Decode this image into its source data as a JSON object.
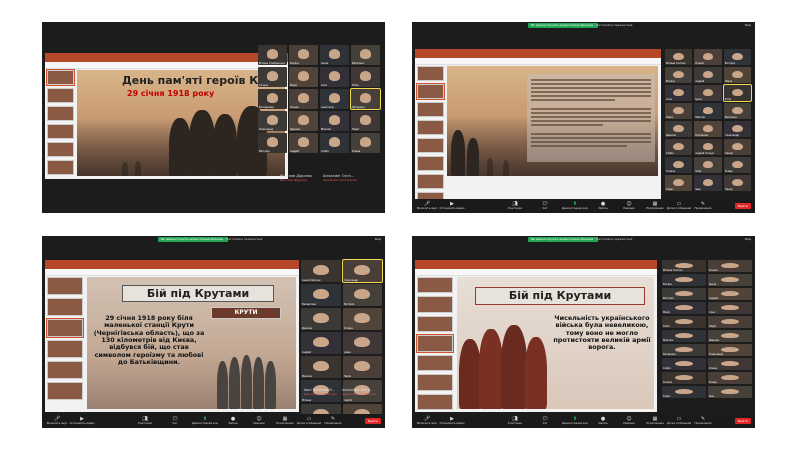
{
  "zoom": {
    "share_banner": "Ви демонструєте екран Олена Франків",
    "share_options": "Настройки презентації",
    "view_label": "Вид",
    "controls": [
      {
        "icon": "mic-icon",
        "label": "Включить звук"
      },
      {
        "icon": "video-icon",
        "label": "Остановить видео"
      },
      {
        "icon": "participants-icon",
        "label": "Участники"
      },
      {
        "icon": "chat-icon",
        "label": "Чат"
      },
      {
        "icon": "share-icon",
        "label": "Демонстрация экрана"
      },
      {
        "icon": "record-icon",
        "label": "Запись"
      },
      {
        "icon": "reactions-icon",
        "label": "Реакции"
      },
      {
        "icon": "apps-icon",
        "label": "Приложения"
      },
      {
        "icon": "whiteboard-icon",
        "label": "Доска сообщений"
      },
      {
        "icon": "notes-icon",
        "label": "Примечания"
      }
    ],
    "end_label": "Выйти",
    "participants_count": "37"
  },
  "slides": {
    "s1": {
      "title": "День пам'яті героїв Крут",
      "date": "29 січня 1918 року"
    },
    "s3": {
      "title": "Бій під Крутами",
      "sign": "КРУТИ",
      "body": "29 січня 1918 року біля маленької станції Крути (Чернігівська область), що за 130 кілометрів від Києва, відбувся бій, що став символом героїзму та любові до Батьківщини."
    },
    "s4": {
      "title": "Бій під Крутами",
      "body": "Чисельність українського війська була невеликою, тому воно не могло протистояти великій армії ворога."
    }
  },
  "participants": {
    "s1": [
      "Мілана Стефанська",
      "Богдан",
      "Ірина",
      "Василько",
      "Гелена",
      "Марія",
      "Соня",
      "Юлія",
      "Володимир",
      "Ксенія",
      "Анастасія",
      "Катерина",
      "Олександр",
      "Дарина",
      "Максим",
      "Надія",
      "Вікторія",
      "Андрій",
      "Софія",
      "Олена"
    ],
    "s2": [
      "Мілана Гнатюк",
      "Ксенія",
      "Вікторія",
      "Богдан",
      "Андрій",
      "Марія",
      "Соня",
      "Ірина",
      "Юлія",
      "Надія",
      "Максим",
      "Василько",
      "Дарина",
      "Катерина",
      "Олександр",
      "Софія",
      "Андрій Ткачук",
      "Олена",
      "Гелена",
      "Олег",
      "Роман",
      "Тарас",
      "Іван",
      "Назар"
    ],
    "s3": [
      "Анна Климчук",
      "Олександр",
      "Валентина",
      "Вікторія",
      "Дарина",
      "Богдан",
      "Андрій",
      "Ірина",
      "Максим",
      "Марія",
      "Мілана",
      "Сергій",
      "Оксана",
      "Юлія"
    ],
    "s4": [
      "Мілана Гнатюк",
      "Ксенія",
      "Богдан",
      "Ірина",
      "Вікторія",
      "Андрій",
      "Марія",
      "Соня",
      "Юлія",
      "Надія",
      "Максим",
      "Дарина",
      "Катерина",
      "Олександр",
      "Софія",
      "Олена",
      "Гелена",
      "Роман",
      "Тарас",
      "Іван"
    ]
  },
  "nameplates": {
    "s1": {
      "left": "Ярослав Дідилюк",
      "left_sub": "Ярослав Дідилюк",
      "right": "Alexander Ovch...",
      "right_sub": "Alexander Ovcharenko"
    },
    "s3": {
      "left": "Іван Кононов В...",
      "left_sub": "Іван Кононов Вотчун",
      "right": "Alexander Ovch...",
      "right_sub": "Alexander Ovcharenko"
    }
  }
}
